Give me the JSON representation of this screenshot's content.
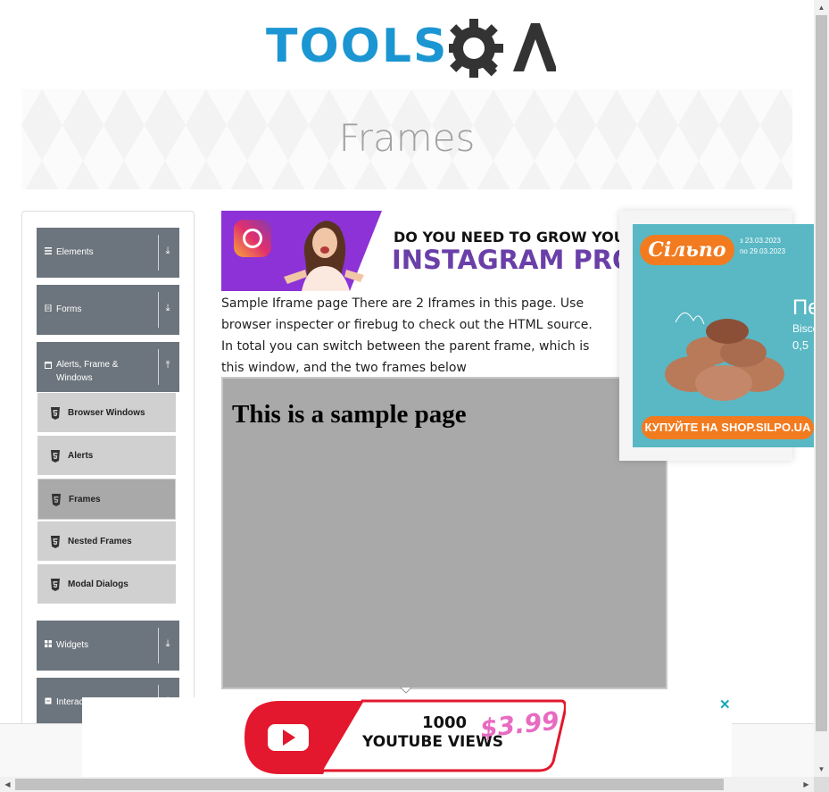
{
  "header": {
    "logo_text": "TOOLS",
    "logo_suffix": "QA"
  },
  "banner": {
    "title": "Frames"
  },
  "menu": {
    "groups": [
      {
        "label": "Elements",
        "icon": "hamburger-icon",
        "arrow": "⤓"
      },
      {
        "label": "Forms",
        "icon": "form-icon",
        "arrow": "⤓"
      },
      {
        "label": "Alerts, Frame & Windows",
        "icon": "window-icon",
        "arrow": "⤒"
      },
      {
        "label": "Widgets",
        "icon": "grid-icon",
        "arrow": "⤓"
      },
      {
        "label": "Interactions",
        "icon": "interaction-icon",
        "arrow": "⤓"
      }
    ],
    "items": [
      {
        "label": "Browser Windows",
        "icon": "html5-icon"
      },
      {
        "label": "Alerts",
        "icon": "html5-icon"
      },
      {
        "label": "Frames",
        "icon": "html5-icon",
        "active": true
      },
      {
        "label": "Nested Frames",
        "icon": "html5-icon"
      },
      {
        "label": "Modal Dialogs",
        "icon": "html5-icon"
      }
    ]
  },
  "ads": {
    "instagram": {
      "line1": "DO YOU NEED TO GROW YOU",
      "line2": "INSTAGRAM PRO"
    },
    "silpo": {
      "logo": "Сільпо",
      "date_from": "з 23.03.2023",
      "date_to": "по 29.03.2023",
      "side1": "Пе",
      "side2": "Bisco",
      "side3": "0,5",
      "button": "КУПУЙТЕ НА SHOP.SILPO.UA"
    },
    "youtube": {
      "line1": "1000",
      "line2": "YOUTUBE VIEWS",
      "price": "$3.99",
      "close": "✕"
    }
  },
  "content": {
    "description": "Sample Iframe page There are 2 Iframes in this page. Use browser inspecter or firebug to check out the HTML source. In total you can switch between the parent frame, which is this window, and the two frames below",
    "iframe_heading": "This is a sample page"
  },
  "colors": {
    "accent": "#1b96d2",
    "menu_group_bg": "#6c757d",
    "menu_item_bg": "#d0d0d0",
    "menu_item_active_bg": "#a9a9a9",
    "iframe_bg": "#a9a9a9"
  },
  "scrollbar": {
    "up": "▲",
    "down": "▼",
    "left": "◀",
    "right": "▶"
  }
}
